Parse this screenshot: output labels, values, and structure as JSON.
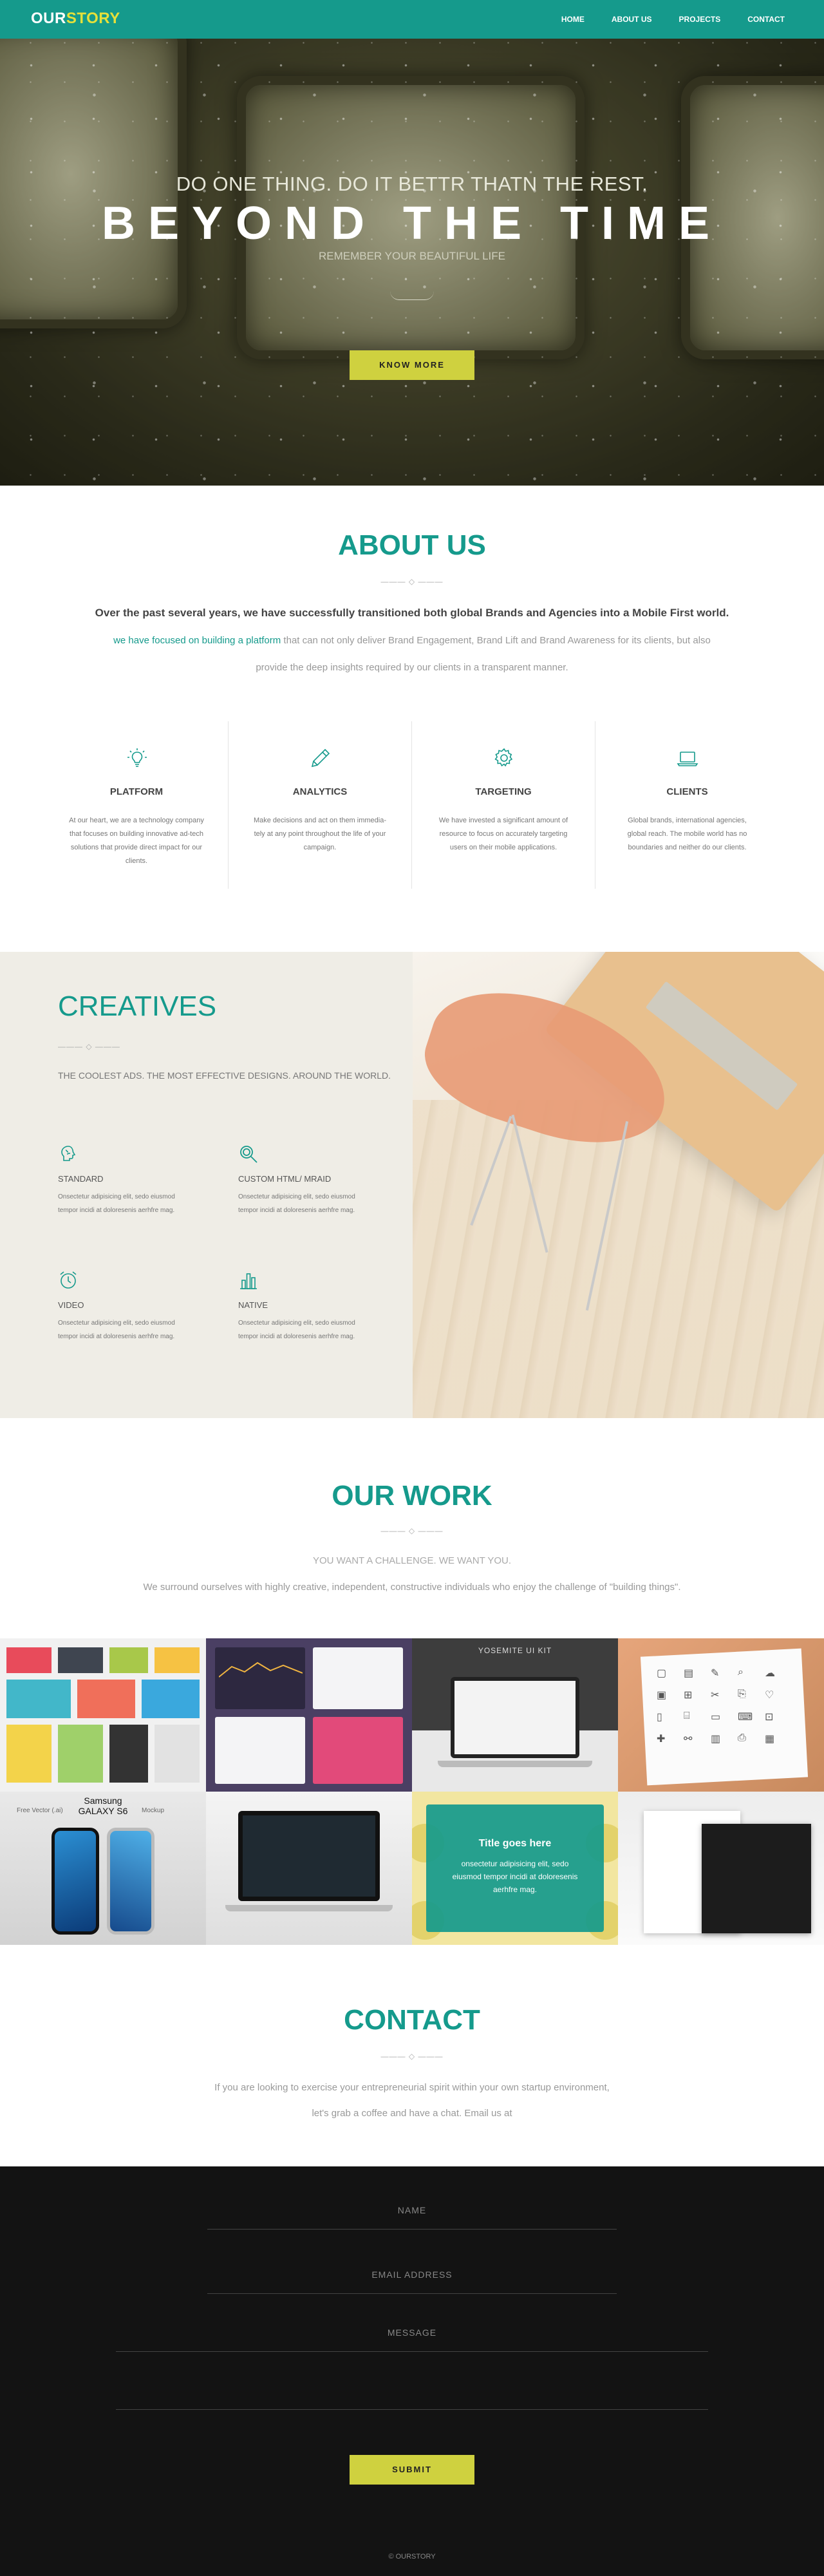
{
  "nav": {
    "logo_a": "OUR",
    "logo_b": "STORY",
    "links": [
      "HOME",
      "ABOUT US",
      "PROJECTS",
      "CONTACT"
    ]
  },
  "hero": {
    "subtitle": "DO ONE THING. DO IT BETTR THATN THE REST.",
    "title": "BEYOND THE TIME",
    "tagline": "REMEMBER YOUR BEAUTIFUL LIFE",
    "button": "KNOW MORE"
  },
  "about": {
    "title": "ABOUT US",
    "lead": "Over the past several years, we have successfully transitioned both global Brands and Agencies into a Mobile First world.",
    "p1_accent": "we have focused on building a platform",
    "p1_rest": " that can not only deliver Brand Engagement, Brand Lift and Brand Awareness for its clients, but also",
    "p2": "provide the deep insights required by our clients in a transparent manner.",
    "features": [
      {
        "icon": "lightbulb-icon",
        "name": "PLATFORM",
        "text": "At our heart, we are a technology company that focuses on building innovative ad-tech solutions that provide direct impact for our clients."
      },
      {
        "icon": "pencil-icon",
        "name": "ANALYTICS",
        "text": "Make decisions and act on them immedia-tely at any point throughout the life of your campaign."
      },
      {
        "icon": "gear-icon",
        "name": "TARGETING",
        "text": "We have invested a significant amount of resource to focus on accurately targeting users on their mobile applications."
      },
      {
        "icon": "laptop-icon",
        "name": "CLIENTS",
        "text": "Global brands, international agencies, global reach. The mobile world has no boundaries and neither do our clients."
      }
    ]
  },
  "creatives": {
    "title": "CREATIVES",
    "subtitle": "THE COOLEST ADS. THE MOST EFFECTIVE DESIGNS. AROUND THE WORLD.",
    "items": [
      {
        "icon": "brain-icon",
        "name": "STANDARD",
        "text": "Onsectetur adipisicing elit, sedo eiusmod tempor incidi at doloresenis aerhfre mag."
      },
      {
        "icon": "magnifier-icon",
        "name": "CUSTOM HTML/ MRAID",
        "text": "Onsectetur adipisicing elit, sedo eiusmod tempor incidi at doloresenis aerhfre mag."
      },
      {
        "icon": "alarm-clock-icon",
        "name": "VIDEO",
        "text": "Onsectetur adipisicing elit, sedo eiusmod tempor incidi at doloresenis aerhfre mag."
      },
      {
        "icon": "bar-chart-icon",
        "name": "NATIVE",
        "text": "Onsectetur adipisicing elit, sedo eiusmod tempor incidi at doloresenis aerhfre mag."
      }
    ]
  },
  "work": {
    "title": "OUR WORK",
    "subtitle": "YOU WANT A CHALLENGE. WE WANT YOU.",
    "desc": "We surround ourselves with highly creative, independent, constructive individuals who enjoy the challenge of \"building things\".",
    "tile_yosemite": "YOSEMITE UI KIT",
    "tile_samsung_brand": "Samsung",
    "tile_samsung_model": "GALAXY S6",
    "tile_samsung_left": "Free Vector (.ai)",
    "tile_samsung_right": "Mockup",
    "tile_overlay_title": "Title goes here",
    "tile_overlay_text": "onsectetur adipisicing elit, sedo eiusmod tempor incidi at doloresenis aerhfre mag."
  },
  "contact": {
    "title": "CONTACT",
    "p1": "If you are looking to exercise your entrepreneurial spirit within your own startup environment,",
    "p2": "let's grab a coffee and have a chat. Email us at",
    "name_placeholder": "NAME",
    "email_placeholder": "EMAIL ADDRESS",
    "message_placeholder": "MESSAGE",
    "submit": "SUBMIT",
    "copyright": "© OURSTORY"
  },
  "colors": {
    "accent": "#159a8c",
    "highlight": "#cfd13f",
    "footer": "#131313"
  }
}
